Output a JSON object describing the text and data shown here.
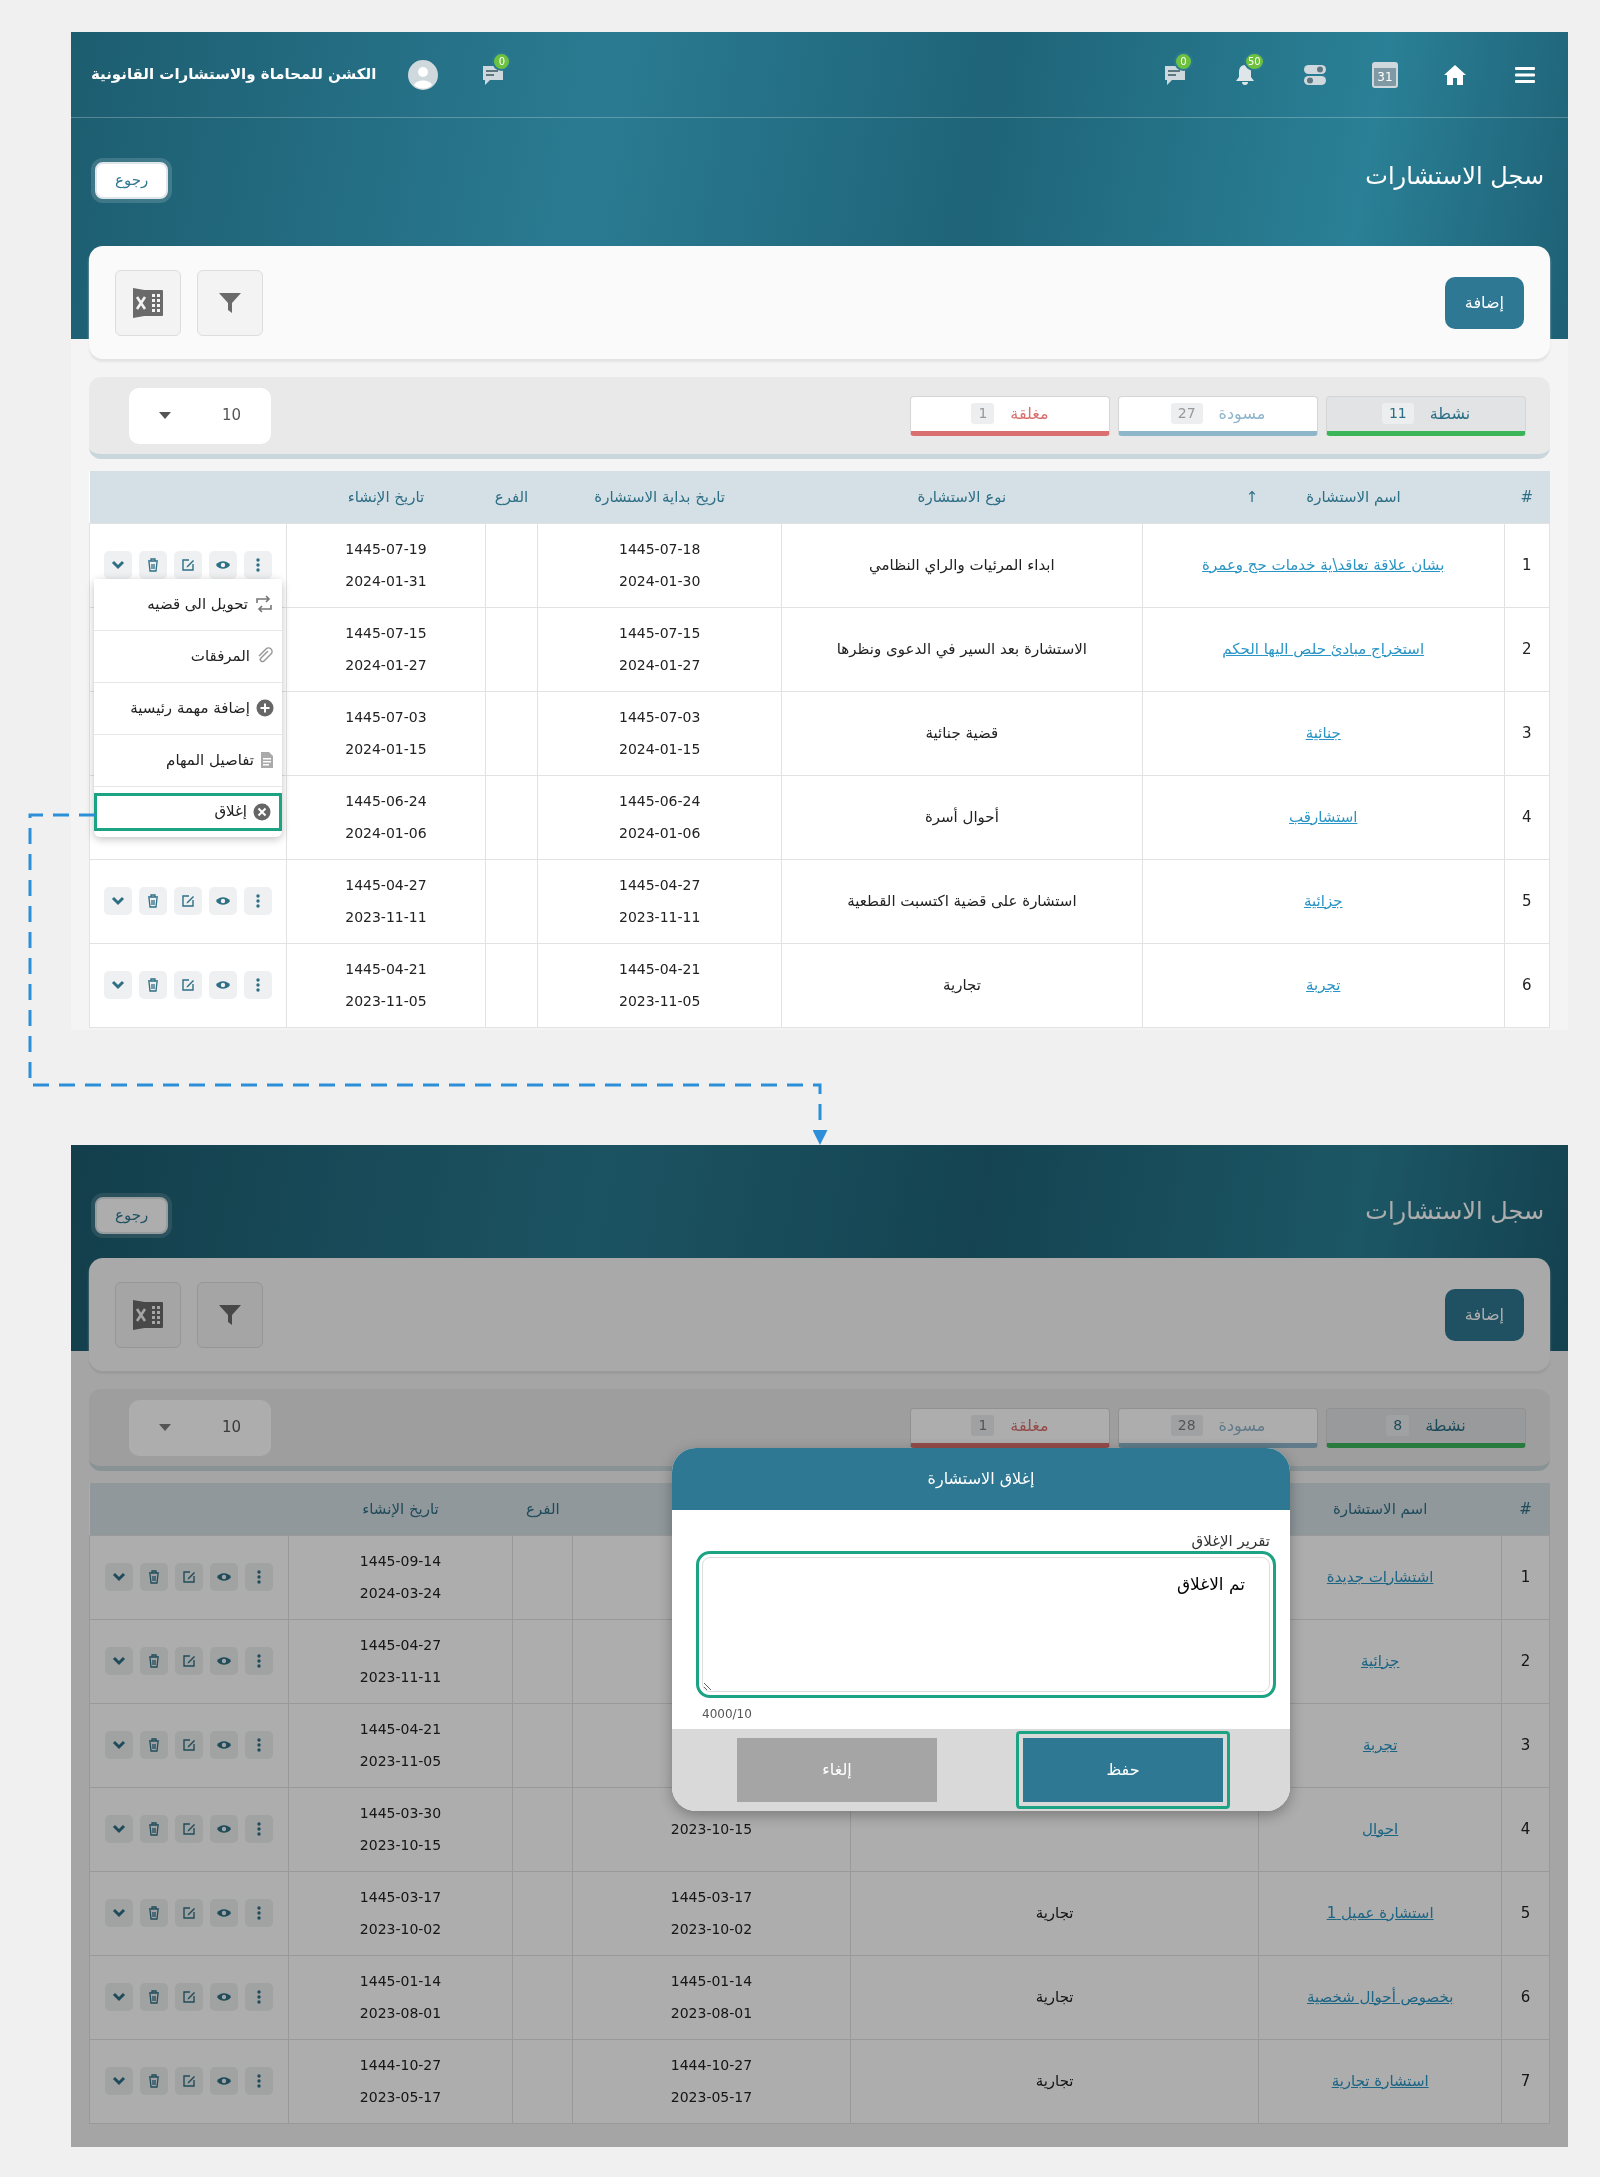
{
  "panels": [
    {
      "topbar": {
        "brand": "الكشن للمحاماة والاستشارات القانونية",
        "messages_count": "0",
        "chat_count": "0",
        "notifications_count": "50",
        "calendar_day": "31"
      },
      "title": "سجل الاستشارات",
      "back_button": "رجوع",
      "add_button": "إضافة",
      "status_tabs": [
        {
          "label": "نشطة",
          "count": "11",
          "color": "#3cb55a",
          "selected": true
        },
        {
          "label": "مسودة",
          "count": "27",
          "color": "#8fb5cb",
          "selected": false
        },
        {
          "label": "مغلقة",
          "count": "1",
          "color": "#d9706f",
          "selected": false
        }
      ],
      "page_size": "10",
      "table": {
        "columns": [
          {
            "label": "#"
          },
          {
            "label": "اسم الاستشارة",
            "sort_icon": "↑"
          },
          {
            "label": "نوع الاستشارة"
          },
          {
            "label": "تاريخ بداية الاستشارة"
          },
          {
            "label": "الفرع"
          },
          {
            "label": "تاريخ الإنشاء"
          }
        ],
        "rows": [
          {
            "index": "1",
            "name": "بشان علاقة تعاقد\\ية خدمات حج وعمرة",
            "type": "ابداء المرئيات والراي النظامي",
            "start_hijri": "1445-07-18",
            "start_date": "2024-01-30",
            "created_hijri": "1445-07-19",
            "created_date": "2024-01-31",
            "actions": true
          },
          {
            "index": "2",
            "name": "استخراج مبادئ حلص اليها الحكم",
            "type": "الاستشارة بعد السير في الدعوى ونظرها",
            "start_hijri": "1445-07-15",
            "start_date": "2024-01-27",
            "created_hijri": "1445-07-15",
            "created_date": "2024-01-27",
            "actions": false
          },
          {
            "index": "3",
            "name": "جنائية",
            "type": "قضية جنائية",
            "start_hijri": "1445-07-03",
            "start_date": "2024-01-15",
            "created_hijri": "1445-07-03",
            "created_date": "2024-01-15",
            "actions": false
          },
          {
            "index": "4",
            "name": "استشارقب",
            "type": "أحوال أسرة",
            "start_hijri": "1445-06-24",
            "start_date": "2024-01-06",
            "created_hijri": "1445-06-24",
            "created_date": "2024-01-06",
            "actions": false
          },
          {
            "index": "5",
            "name": "جزائية",
            "type": "استشارة على قضية اكتسبت القطعية",
            "start_hijri": "1445-04-27",
            "start_date": "2023-11-11",
            "created_hijri": "1445-04-27",
            "created_date": "2023-11-11",
            "actions": true
          },
          {
            "index": "6",
            "name": "تجربة",
            "type": "تجارية",
            "start_hijri": "1445-04-21",
            "start_date": "2023-11-05",
            "created_hijri": "1445-04-21",
            "created_date": "2023-11-05",
            "actions": true
          }
        ]
      },
      "action_menu": {
        "items": [
          {
            "kind": "convert",
            "label": "تحويل الى قضيه",
            "selected": false
          },
          {
            "kind": "attachments",
            "label": "المرفقات",
            "selected": false
          },
          {
            "kind": "add",
            "label": "إضافة مهمة رئيسية",
            "selected": false
          },
          {
            "kind": "details",
            "label": "تفاصيل المهام",
            "selected": false
          },
          {
            "kind": "close",
            "label": "إغلاق",
            "selected": true
          }
        ]
      }
    },
    {
      "title": "سجل الاستشارات",
      "back_button": "رجوع",
      "add_button": "إضافة",
      "status_tabs": [
        {
          "label": "نشطة",
          "count": "8",
          "color": "#297b3d",
          "selected": true
        },
        {
          "label": "مسودة",
          "count": "28",
          "color": "#617b8a",
          "selected": false
        },
        {
          "label": "مغلقة",
          "count": "1",
          "color": "#934c4b",
          "selected": false
        }
      ],
      "page_size": "10",
      "table": {
        "columns": [
          {
            "label": "#"
          },
          {
            "label": "اسم الاستشارة"
          },
          {},
          {},
          {
            "label": "الفرع"
          },
          {
            "label": "تاريخ الإنشاء"
          }
        ],
        "rows": [
          {
            "index": "1",
            "name": "اشتشارات جديدة",
            "created_hijri": "1445-09-14",
            "created_date": "2024-03-24",
            "actions": true
          },
          {
            "index": "2",
            "name": "جزائية",
            "created_hijri": "1445-04-27",
            "created_date": "2023-11-11",
            "actions": true
          },
          {
            "index": "3",
            "name": "تجربة",
            "created_hijri": "1445-04-21",
            "created_date": "2023-11-05",
            "actions": true
          },
          {
            "index": "4",
            "name": "احوال",
            "start_date": "2023-10-15",
            "created_hijri": "1445-03-30",
            "created_date": "2023-10-15",
            "actions": true
          },
          {
            "index": "5",
            "name": "استشارة عميل 1",
            "type": "تجارية",
            "start_hijri": "1445-03-17",
            "start_date": "2023-10-02",
            "created_hijri": "1445-03-17",
            "created_date": "2023-10-02",
            "actions": true
          },
          {
            "index": "6",
            "name": "بخصوص أحوال شخصية",
            "type": "تجارية",
            "start_hijri": "1445-01-14",
            "start_date": "2023-08-01",
            "created_hijri": "1445-01-14",
            "created_date": "2023-08-01",
            "actions": true
          },
          {
            "index": "7",
            "name": "استشارة تجارية",
            "type": "تجارية",
            "start_hijri": "1444-10-27",
            "start_date": "2023-05-17",
            "created_hijri": "1444-10-27",
            "created_date": "2023-05-17",
            "actions": true
          }
        ]
      },
      "modal": {
        "title": "إغلاق الاستشارة",
        "field_label": "تقرير الإغلاق",
        "value": "تم الاغلاق",
        "highlighted": true,
        "counter": "4000/10",
        "buttons": [
          {
            "kind": "save",
            "label": "حفظ",
            "highlighted": true
          },
          {
            "kind": "cancel",
            "label": "إلغاء",
            "highlighted": false
          }
        ]
      }
    }
  ]
}
